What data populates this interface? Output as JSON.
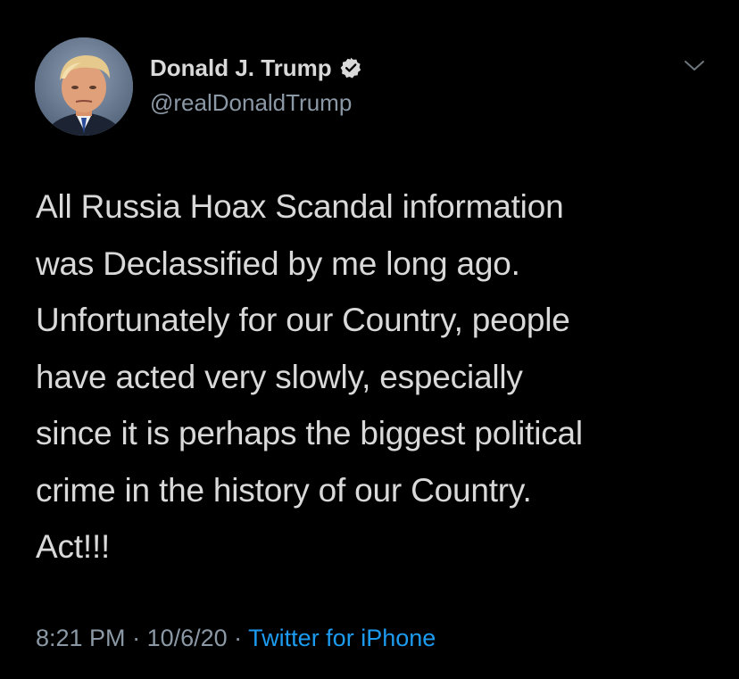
{
  "user": {
    "display_name": "Donald J. Trump",
    "handle": "@realDonaldTrump",
    "verified": true
  },
  "icons": {
    "avatar": "profile-photo",
    "verified": "verified-badge-icon",
    "menu": "chevron-down-icon"
  },
  "tweet": {
    "text": "All Russia Hoax Scandal information\nwas Declassified by me long ago.\nUnfortunately for our Country, people\nhave acted very slowly, especially\nsince it is perhaps the biggest political\ncrime in the history of our Country.\nAct!!!"
  },
  "meta": {
    "time": "8:21 PM",
    "separator": " · ",
    "date": "10/6/20",
    "source": "Twitter for iPhone"
  },
  "colors": {
    "background": "#000000",
    "text": "#d9d9d9",
    "secondary": "#8b98a5",
    "link": "#1d9bf0"
  }
}
